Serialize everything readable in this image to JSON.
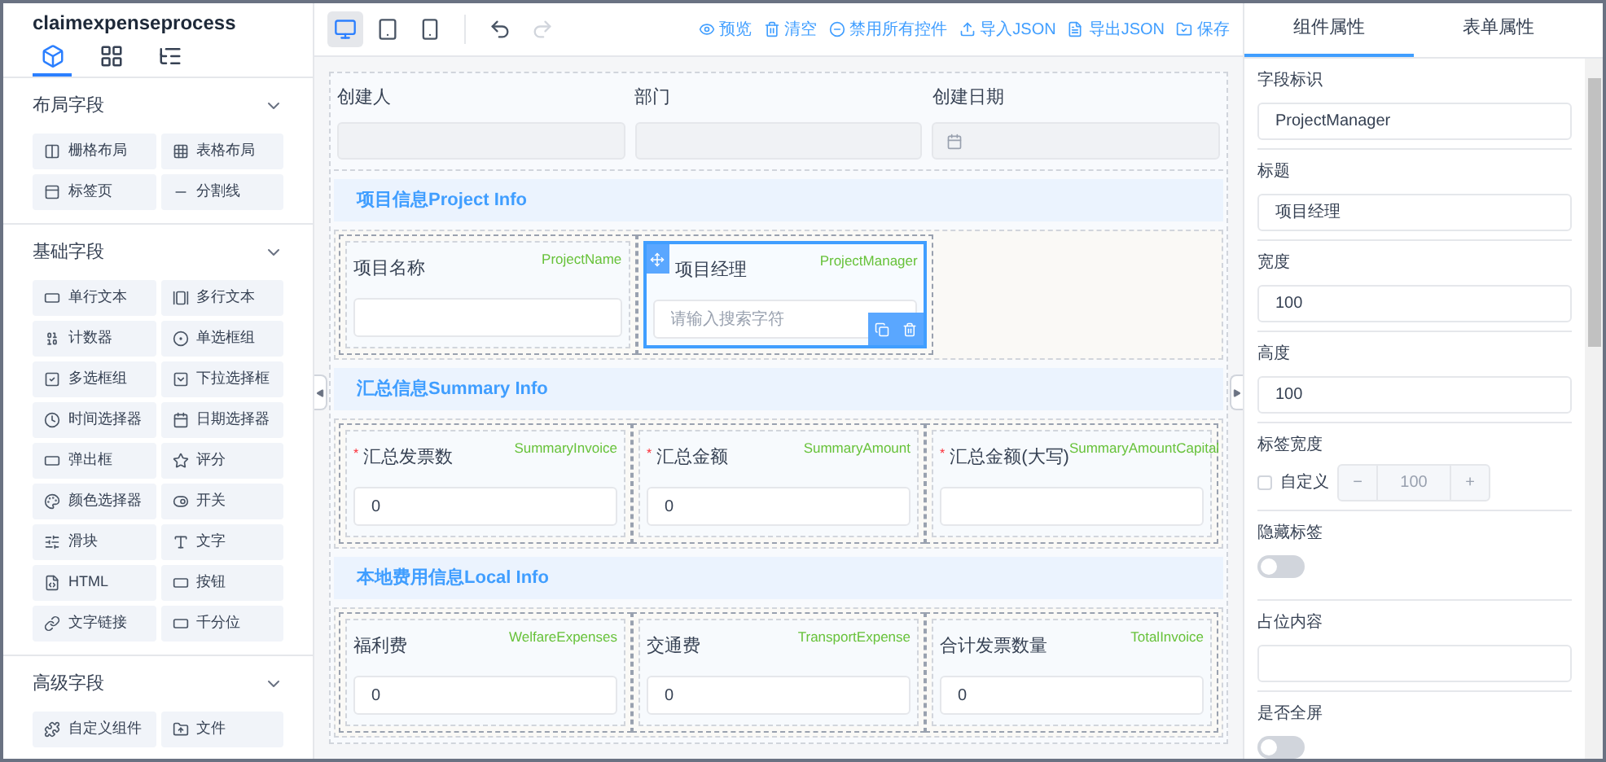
{
  "app_title": "claimexpenseprocess",
  "palette_tabs": [
    {
      "selected": true
    },
    {
      "selected": false
    },
    {
      "selected": false
    }
  ],
  "palette_sections": [
    {
      "title": "布局字段",
      "expanded": true,
      "items": [
        "栅格布局",
        "表格布局",
        "标签页",
        "分割线"
      ]
    },
    {
      "title": "基础字段",
      "expanded": true,
      "items": [
        "单行文本",
        "多行文本",
        "计数器",
        "单选框组",
        "多选框组",
        "下拉选择框",
        "时间选择器",
        "日期选择器",
        "弹出框",
        "评分",
        "颜色选择器",
        "开关",
        "滑块",
        "文字",
        "HTML",
        "按钮",
        "文字链接",
        "千分位"
      ]
    },
    {
      "title": "高级字段",
      "expanded": true,
      "items": [
        "自定义组件",
        "文件"
      ]
    }
  ],
  "toolbar": {
    "devices": [
      {
        "selected": true
      },
      {
        "selected": false
      },
      {
        "selected": false
      }
    ],
    "undo": {
      "disabled": false
    },
    "redo": {
      "disabled": true
    },
    "actions": [
      "预览",
      "清空",
      "禁用所有控件",
      "导入JSON",
      "导出JSON",
      "保存"
    ]
  },
  "top_fields": [
    {
      "label": "创建人",
      "kind": "text"
    },
    {
      "label": "部门",
      "kind": "text"
    },
    {
      "label": "创建日期",
      "kind": "date"
    }
  ],
  "sections": [
    {
      "title": "项目信息Project Info",
      "fields": [
        {
          "label": "项目名称",
          "field_id": "ProjectName",
          "selected": false
        },
        {
          "label": "项目经理",
          "field_id": "ProjectManager",
          "placeholder": "请输入搜索字符",
          "selected": true
        }
      ]
    },
    {
      "title": "汇总信息Summary Info",
      "fields": [
        {
          "label": "汇总发票数",
          "field_id": "SummaryInvoice",
          "required_mark": "*",
          "value": "0",
          "selected": false
        },
        {
          "label": "汇总金额",
          "field_id": "SummaryAmount",
          "required_mark": "*",
          "value": "0",
          "selected": false
        },
        {
          "label": "汇总金额(大写)",
          "field_id": "SummaryAmountCapital",
          "required_mark": "*",
          "selected": false
        }
      ]
    },
    {
      "title": "本地费用信息Local Info",
      "fields": [
        {
          "label": "福利费",
          "field_id": "WelfareExpenses",
          "value": "0",
          "selected": false
        },
        {
          "label": "交通费",
          "field_id": "TransportExpense",
          "value": "0",
          "selected": false
        },
        {
          "label": "合计发票数量",
          "field_id": "TotalInvoice",
          "value": "0",
          "selected": false
        }
      ]
    }
  ],
  "properties": {
    "tabs": [
      {
        "label": "组件属性",
        "selected": true
      },
      {
        "label": "表单属性",
        "selected": false
      }
    ],
    "items": [
      {
        "kind": "input",
        "label": "字段标识",
        "value": "ProjectManager"
      },
      {
        "kind": "input",
        "label": "标题",
        "value": "项目经理"
      },
      {
        "kind": "input",
        "label": "宽度",
        "value": "100"
      },
      {
        "kind": "input",
        "label": "高度",
        "value": "100"
      },
      {
        "kind": "custom_number",
        "label": "标签宽度",
        "checkbox_label": "自定义",
        "checked": false,
        "value": "100",
        "minus": "−",
        "plus": "+"
      },
      {
        "kind": "switch",
        "label": "隐藏标签",
        "on": false
      },
      {
        "kind": "input",
        "label": "占位内容"
      },
      {
        "kind": "switch",
        "label": "是否全屏",
        "on": false
      }
    ]
  }
}
